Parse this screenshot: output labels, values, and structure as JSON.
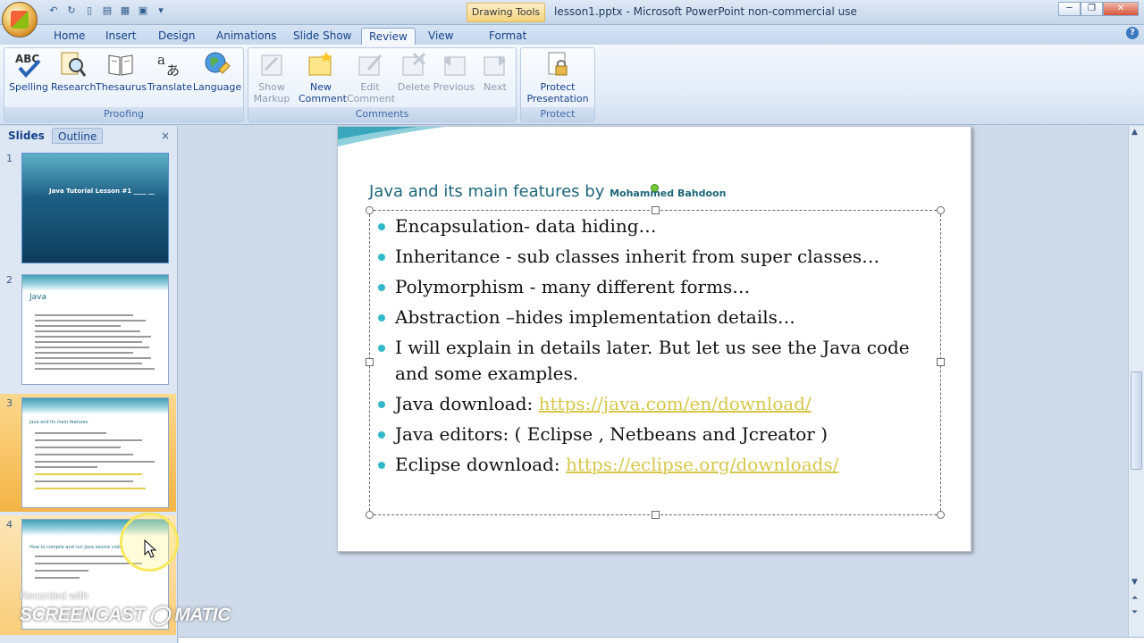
{
  "window": {
    "contextual_tab": "Drawing Tools",
    "title": "lesson1.pptx - Microsoft PowerPoint non-commercial use"
  },
  "ribbon_tabs": [
    "Home",
    "Insert",
    "Design",
    "Animations",
    "Slide Show",
    "Review",
    "View",
    "Format"
  ],
  "active_tab": "Review",
  "groups": {
    "proofing": {
      "label": "Proofing",
      "buttons": [
        "Spelling",
        "Research",
        "Thesaurus",
        "Translate",
        "Language"
      ]
    },
    "comments": {
      "label": "Comments",
      "show_markup": [
        "Show",
        "Markup"
      ],
      "new_comment": [
        "New",
        "Comment"
      ],
      "edit_comment": [
        "Edit",
        "Comment"
      ],
      "delete": "Delete",
      "previous": "Previous",
      "next": "Next"
    },
    "protect": {
      "label": "Protect",
      "protect_presentation": [
        "Protect",
        "Presentation ▾"
      ]
    }
  },
  "panel": {
    "tab_slides": "Slides",
    "tab_outline": "Outline",
    "close": "×",
    "thumbnails": [
      {
        "num": "1",
        "title": "Java Tutorial Lesson #1 ____ __"
      },
      {
        "num": "2",
        "title": "Java"
      },
      {
        "num": "3",
        "title": "Java and its main features"
      },
      {
        "num": "4",
        "title": "How to compile and run Java source code"
      }
    ]
  },
  "slide": {
    "title": "Java and its main features by",
    "author": "Mohammed Bahdoon",
    "bullets": [
      {
        "text": "Encapsulation- data hiding…",
        "link": ""
      },
      {
        "text": "Inheritance  - sub classes inherit from super classes…",
        "link": ""
      },
      {
        "text": "Polymorphism  - many different forms…",
        "link": ""
      },
      {
        "text": "Abstraction –hides implementation details…",
        "link": ""
      },
      {
        "text": "I will explain in details later. But let us see the Java code and some examples.",
        "link": ""
      },
      {
        "text": "Java download:  ",
        "link": "https://java.com/en/download/"
      },
      {
        "text": "Java editors: ( Eclipse , Netbeans  and Jcreator )",
        "link": ""
      },
      {
        "text": "Eclipse download: ",
        "link": "https://eclipse.org/downloads/"
      }
    ]
  },
  "watermark": {
    "line1": "Recorded with",
    "line2": "SCREENCAST ◯ MATIC"
  },
  "colors": {
    "accent": "#1d6679",
    "bullet": "#33b8c9",
    "link": "#d6c74b",
    "selected_row": "#f4b445"
  }
}
